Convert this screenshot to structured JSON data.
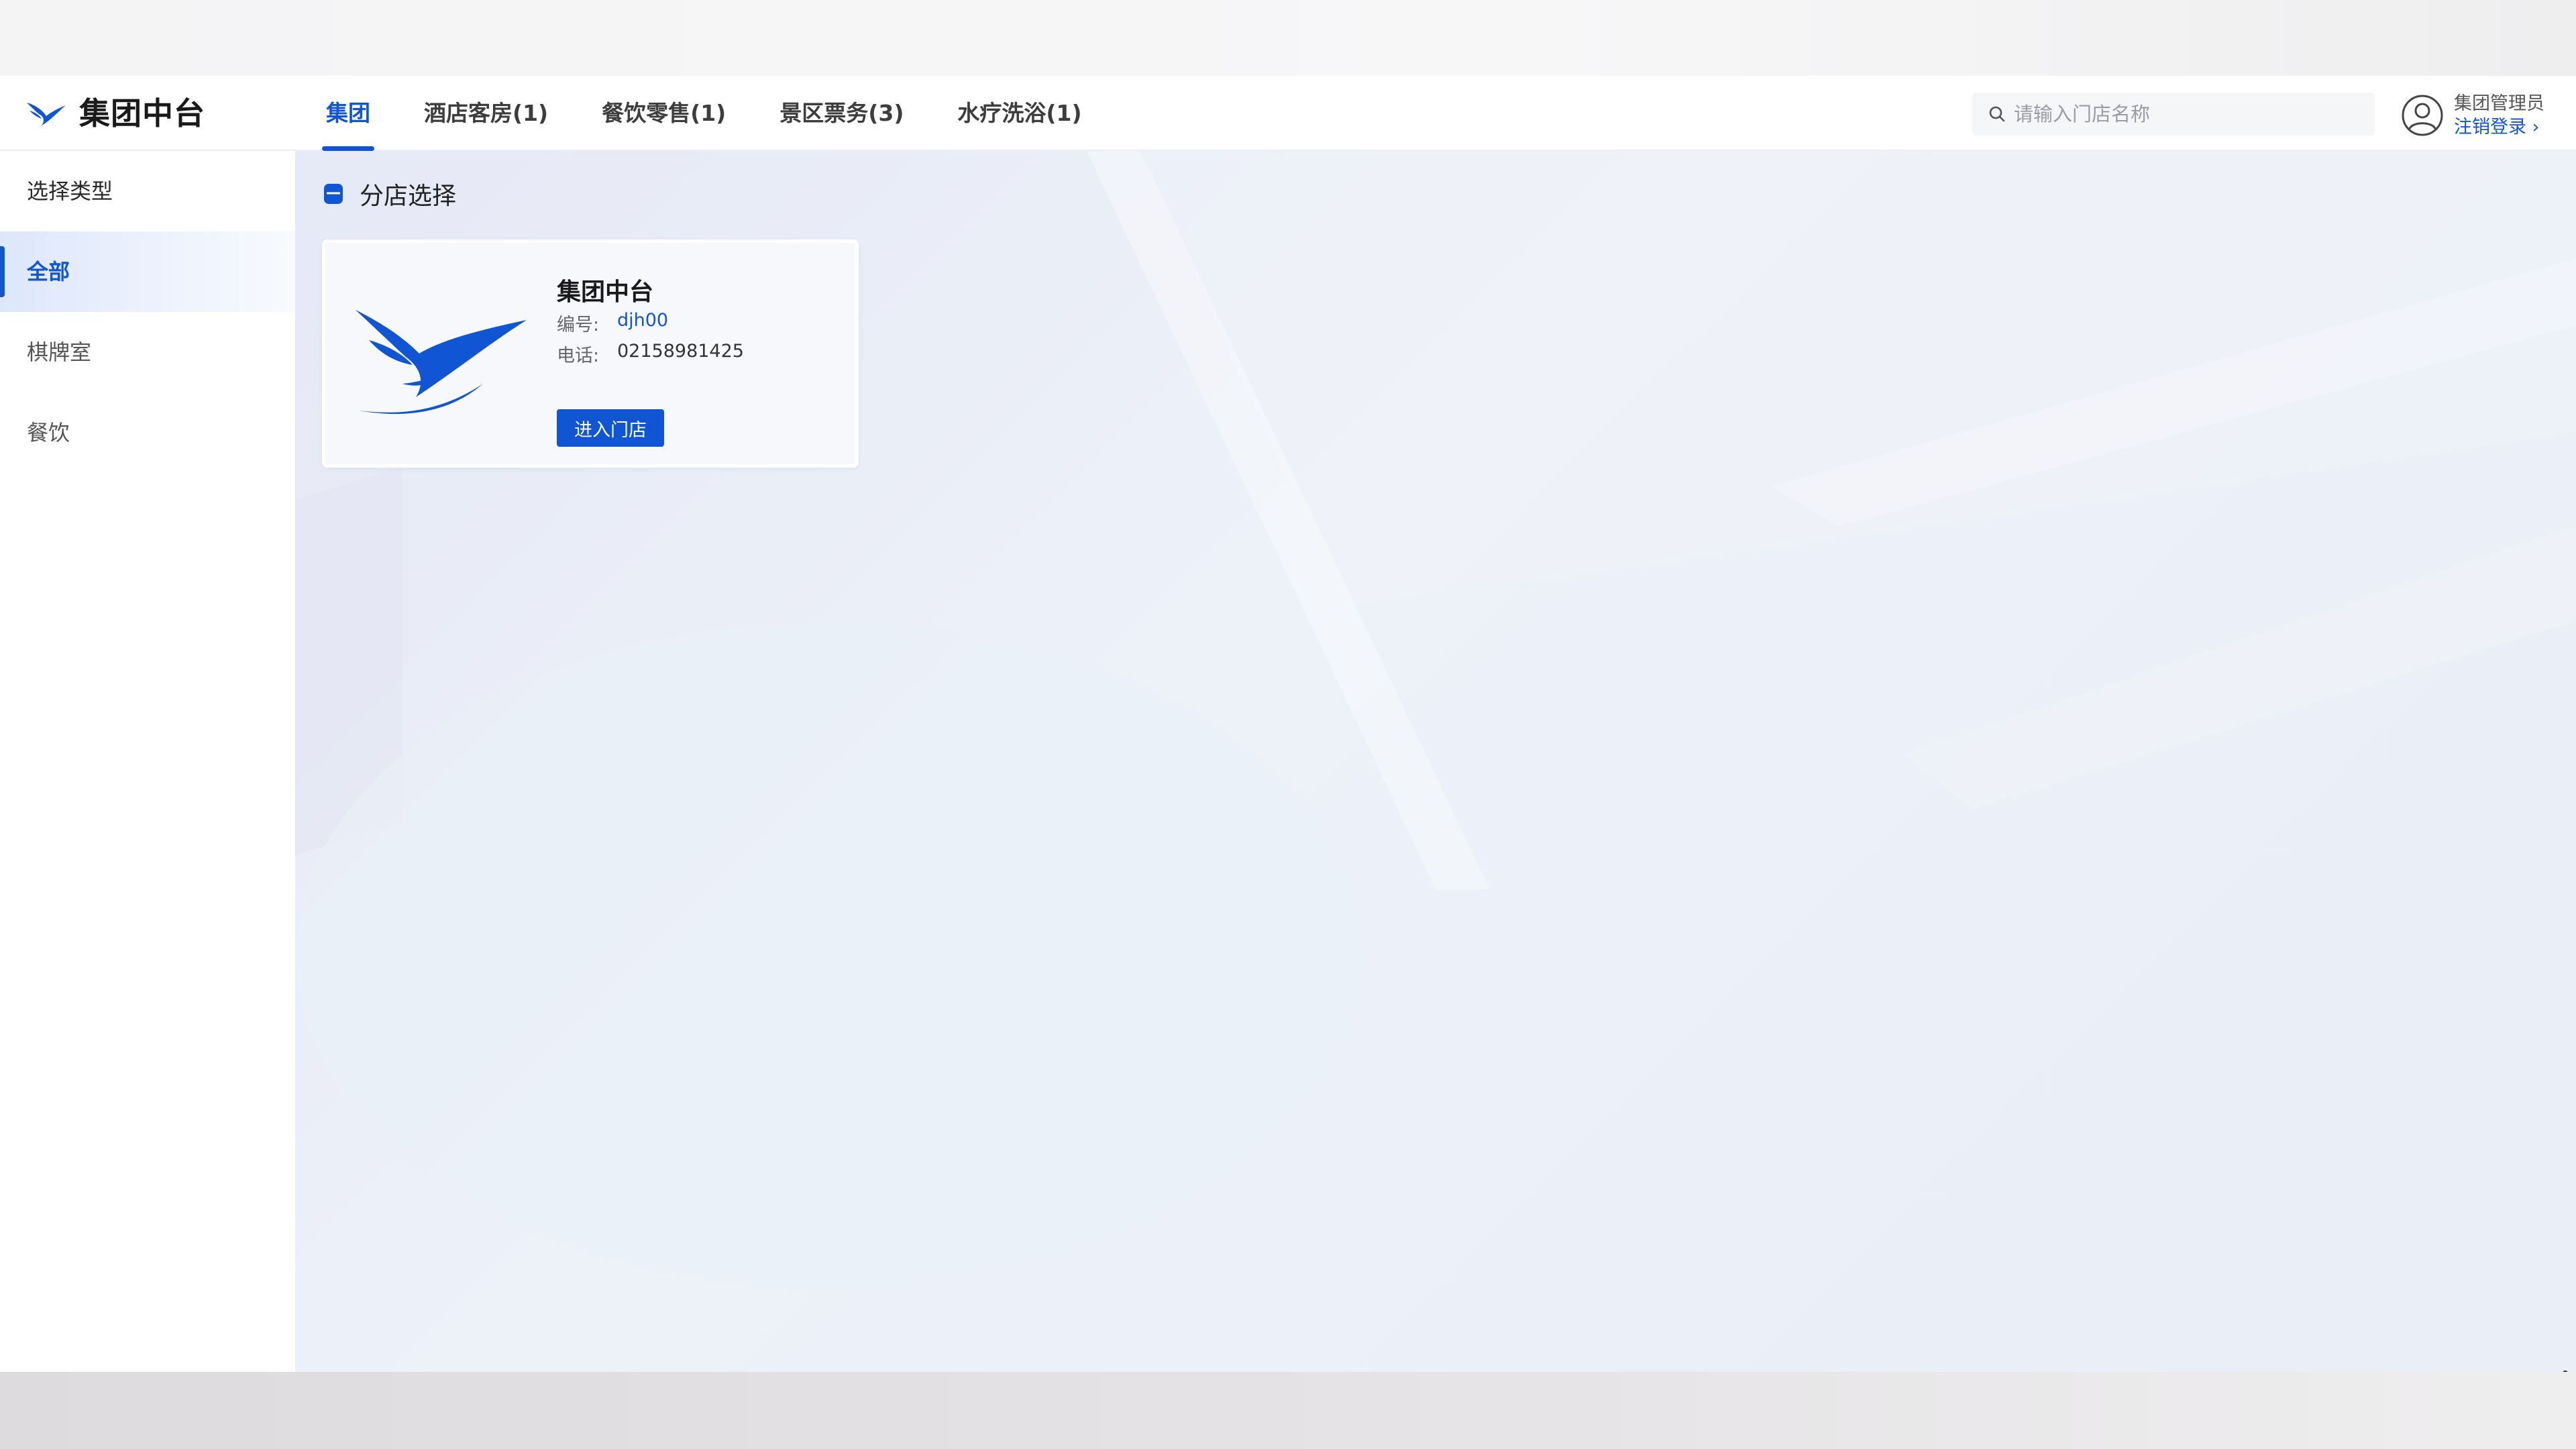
{
  "header": {
    "brand": "集团中台",
    "tabs": [
      {
        "label": "集团",
        "active": true
      },
      {
        "label": "酒店客房(1)",
        "active": false
      },
      {
        "label": "餐饮零售(1)",
        "active": false
      },
      {
        "label": "景区票务(3)",
        "active": false
      },
      {
        "label": "水疗洗浴(1)",
        "active": false
      }
    ],
    "search": {
      "placeholder": "请输入门店名称",
      "value": ""
    },
    "user": {
      "name": "集团管理员",
      "logout_label": "注销登录 ›"
    }
  },
  "sidebar": {
    "heading": "选择类型",
    "items": [
      {
        "label": "全部",
        "active": true
      },
      {
        "label": "棋牌室",
        "active": false
      },
      {
        "label": "餐饮",
        "active": false
      }
    ]
  },
  "main": {
    "section_title": "分店选择",
    "stores": [
      {
        "name": "集团中台",
        "code_label": "编号:",
        "code": "djh00",
        "phone_label": "电话:",
        "phone": "02158981425",
        "enter_label": "进入门店"
      }
    ]
  },
  "colors": {
    "accent": "#1055d3",
    "background": "#eaeef7",
    "text": "#1a1a1a"
  },
  "icons": [
    "bird-logo-icon",
    "search-icon",
    "user-avatar-icon",
    "store-section-icon"
  ]
}
